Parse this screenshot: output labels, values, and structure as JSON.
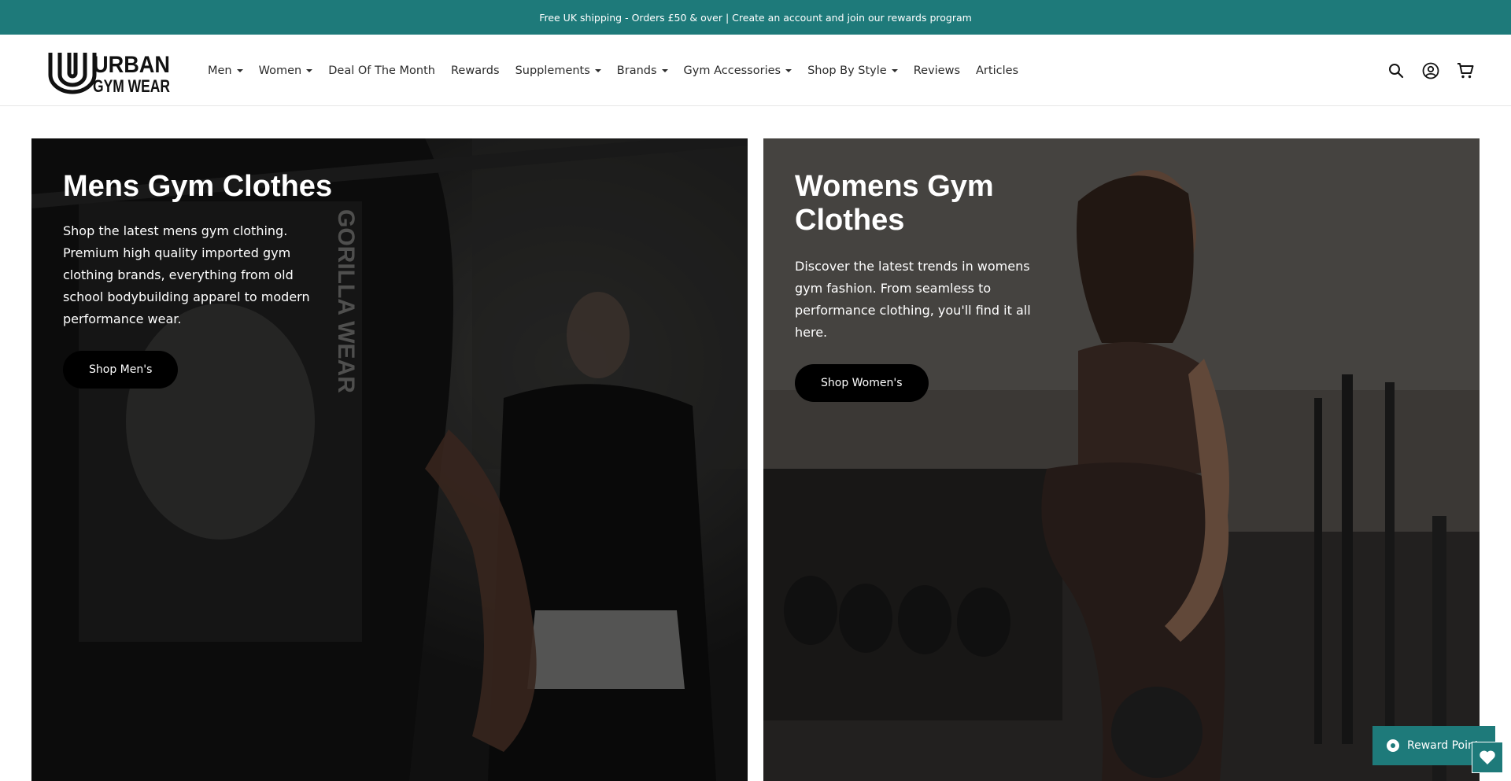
{
  "announcement": {
    "text": "Free UK shipping - Orders £50 & over | Create an account and join our rewards program"
  },
  "header": {
    "logo_line1": "URBAN",
    "logo_line2": "GYM WEAR",
    "nav": [
      {
        "label": "Men",
        "dropdown": true
      },
      {
        "label": "Women",
        "dropdown": true
      },
      {
        "label": "Deal Of The Month",
        "dropdown": false
      },
      {
        "label": "Rewards",
        "dropdown": false
      },
      {
        "label": "Supplements",
        "dropdown": true
      },
      {
        "label": "Brands",
        "dropdown": true
      },
      {
        "label": "Gym Accessories",
        "dropdown": true
      },
      {
        "label": "Shop By Style",
        "dropdown": true
      },
      {
        "label": "Reviews",
        "dropdown": false
      },
      {
        "label": "Articles",
        "dropdown": false
      }
    ],
    "icons": [
      "search-icon",
      "account-icon",
      "cart-icon"
    ]
  },
  "panels": {
    "men": {
      "title": "Mens Gym Clothes",
      "text": "Shop the latest mens gym clothing. Premium high quality imported gym clothing brands, everything from old school bodybuilding apparel to modern performance wear.",
      "button": "Shop Men's",
      "image_text": "GORILLA WEAR"
    },
    "women": {
      "title": "Womens Gym Clothes",
      "text": "Discover the latest trends in womens gym fashion. From seamless to performance clothing, you'll find it all here.",
      "button": "Shop Women's"
    }
  },
  "widgets": {
    "rewards_label": "Reward Points"
  },
  "colors": {
    "brand_teal": "#1e7a7a",
    "button_black": "#000000"
  }
}
